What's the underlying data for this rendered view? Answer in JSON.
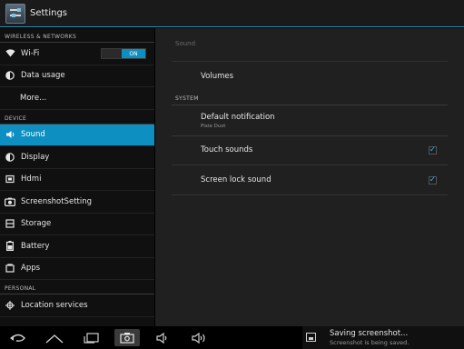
{
  "action_bar": {
    "title": "Settings",
    "icon": "settings-icon"
  },
  "left_pane": {
    "header_wireless": "WIRELESS & NETWORKS",
    "wifi": {
      "label": "Wi-Fi",
      "toggle_state": "ON"
    },
    "data_usage": "Data usage",
    "more": "More...",
    "header_device": "DEVICE",
    "sound": "Sound",
    "display": "Display",
    "hdmi": "Hdmi",
    "screenshot_setting": "ScreenshotSetting",
    "storage": "Storage",
    "battery": "Battery",
    "apps": "Apps",
    "header_personal": "PERSONAL",
    "location": "Location services"
  },
  "right_pane": {
    "title": "Sound",
    "volumes": "Volumes",
    "header_system": "SYSTEM",
    "default_notification": {
      "title": "Default notification",
      "summary": "Pixie Dust"
    },
    "touch_sounds": {
      "title": "Touch sounds",
      "checked": true
    },
    "screen_lock_sound": {
      "title": "Screen lock sound",
      "checked": true
    }
  },
  "nav_bar": {
    "notification_title": "Saving screenshot...",
    "notification_text": "Screenshot is being saved."
  },
  "colors": {
    "accent": "#0e8fc1",
    "check": "#33b5e5"
  }
}
